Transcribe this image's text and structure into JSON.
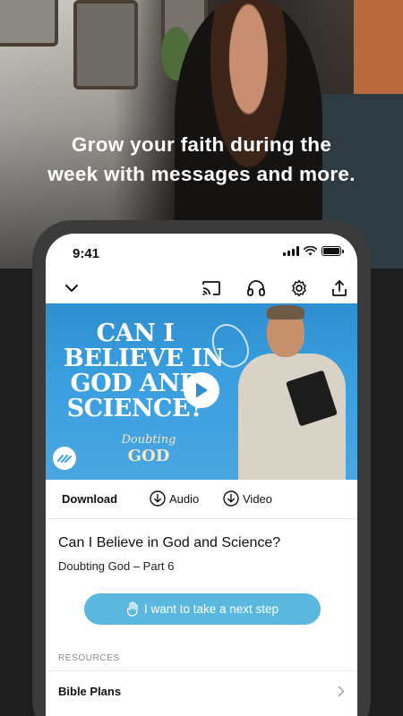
{
  "promo": {
    "line1": "Grow your faith during the",
    "line2": "week with messages and more."
  },
  "status": {
    "time": "9:41"
  },
  "toolbar": {
    "icons": [
      "chevron-down-icon",
      "cast-icon",
      "headphones-icon",
      "gear-icon",
      "share-icon"
    ]
  },
  "video": {
    "title_lines": [
      "CAN I",
      "BELIEVE IN",
      "GOD AND",
      "SCIENCE?"
    ],
    "series_line1": "Doubting",
    "series_line2": "GOD"
  },
  "downloads": {
    "label": "Download",
    "audio": "Audio",
    "video": "Video"
  },
  "message": {
    "title": "Can I Believe in God and Science?",
    "subtitle": "Doubting God – Part 6"
  },
  "cta": {
    "label": "I want to take a next step"
  },
  "resources": {
    "header": "RESOURCES",
    "items": [
      {
        "label": "Bible Plans"
      }
    ]
  },
  "colors": {
    "accent": "#5ab8df",
    "video_bg": "#3a9fe0",
    "phone_frame": "#3b3b3b"
  }
}
